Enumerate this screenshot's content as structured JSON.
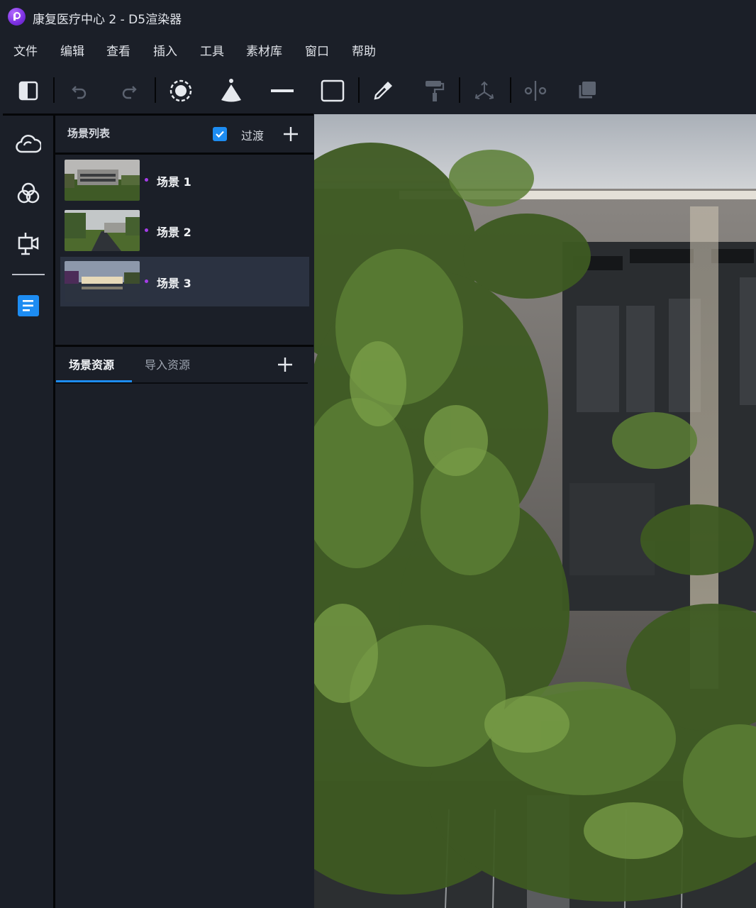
{
  "window": {
    "title": "康复医疗中心 2 - D5渲染器",
    "logo_icon": "d5-logo-icon"
  },
  "menu": [
    "文件",
    "编辑",
    "查看",
    "插入",
    "工具",
    "素材库",
    "窗口",
    "帮助"
  ],
  "toolbar": {
    "tools": [
      {
        "name": "toggle-panel-icon",
        "enabled": true
      },
      {
        "name": "undo-icon",
        "enabled": false
      },
      {
        "name": "redo-icon",
        "enabled": false
      },
      {
        "name": "point-light-icon",
        "enabled": true
      },
      {
        "name": "spot-light-icon",
        "enabled": true
      },
      {
        "name": "strip-light-icon",
        "enabled": true
      },
      {
        "name": "rect-light-icon",
        "enabled": true
      },
      {
        "name": "eyedropper-icon",
        "enabled": true
      },
      {
        "name": "paint-roller-icon",
        "enabled": false
      },
      {
        "name": "transform-axis-icon",
        "enabled": false
      },
      {
        "name": "align-icon",
        "enabled": false
      },
      {
        "name": "duplicate-icon",
        "enabled": false
      }
    ]
  },
  "sidebar": {
    "items": [
      {
        "icon": "environment-cloud-icon"
      },
      {
        "icon": "materials-icon"
      },
      {
        "icon": "camera-icon"
      },
      {
        "icon": "scene-list-icon",
        "active": true
      }
    ]
  },
  "scene_panel": {
    "title": "场景列表",
    "transition_label": "过渡",
    "transition_checked": true,
    "scenes": [
      {
        "label": "场景 1",
        "active": false
      },
      {
        "label": "场景 2",
        "active": false
      },
      {
        "label": "场景 3",
        "active": true
      }
    ]
  },
  "assets_panel": {
    "tabs": [
      {
        "label": "场景资源",
        "active": true
      },
      {
        "label": "导入资源",
        "active": false
      }
    ]
  },
  "colors": {
    "background": "#1b1f28",
    "accent": "#1d8cf2",
    "scene_dot": "#a53de8",
    "selected_row": "#2b3241"
  }
}
